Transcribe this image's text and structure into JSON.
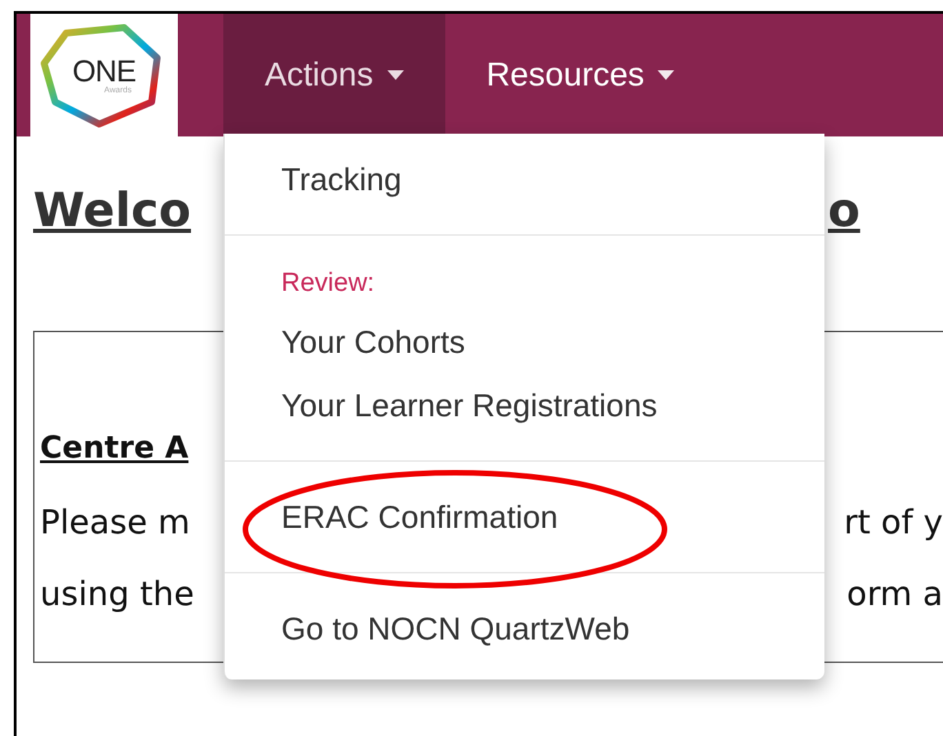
{
  "navbar": {
    "logo": {
      "name": "ONE",
      "tagline": "Awards"
    },
    "tabs": [
      {
        "label": "Actions",
        "selected": true,
        "expanded": true
      },
      {
        "label": "Resources",
        "selected": false,
        "expanded": false
      }
    ]
  },
  "dropdown": {
    "items": [
      {
        "kind": "item",
        "label": "Tracking",
        "highlighted": false
      },
      {
        "kind": "divider"
      },
      {
        "kind": "header",
        "label": "Review:"
      },
      {
        "kind": "item",
        "label": "Your Cohorts",
        "highlighted": false
      },
      {
        "kind": "item",
        "label": "Your Learner Registrations",
        "highlighted": false
      },
      {
        "kind": "divider"
      },
      {
        "kind": "item",
        "label": "ERAC Confirmation",
        "highlighted": true
      },
      {
        "kind": "divider"
      },
      {
        "kind": "item",
        "label": "Go to NOCN QuartzWeb",
        "highlighted": false
      }
    ]
  },
  "page": {
    "heading": {
      "left": "Welco",
      "right": "o"
    },
    "section_title": "Centre A",
    "lines": [
      {
        "left": "Please m",
        "right": "rt of y"
      },
      {
        "left": "using the",
        "right": "orm a"
      }
    ]
  }
}
